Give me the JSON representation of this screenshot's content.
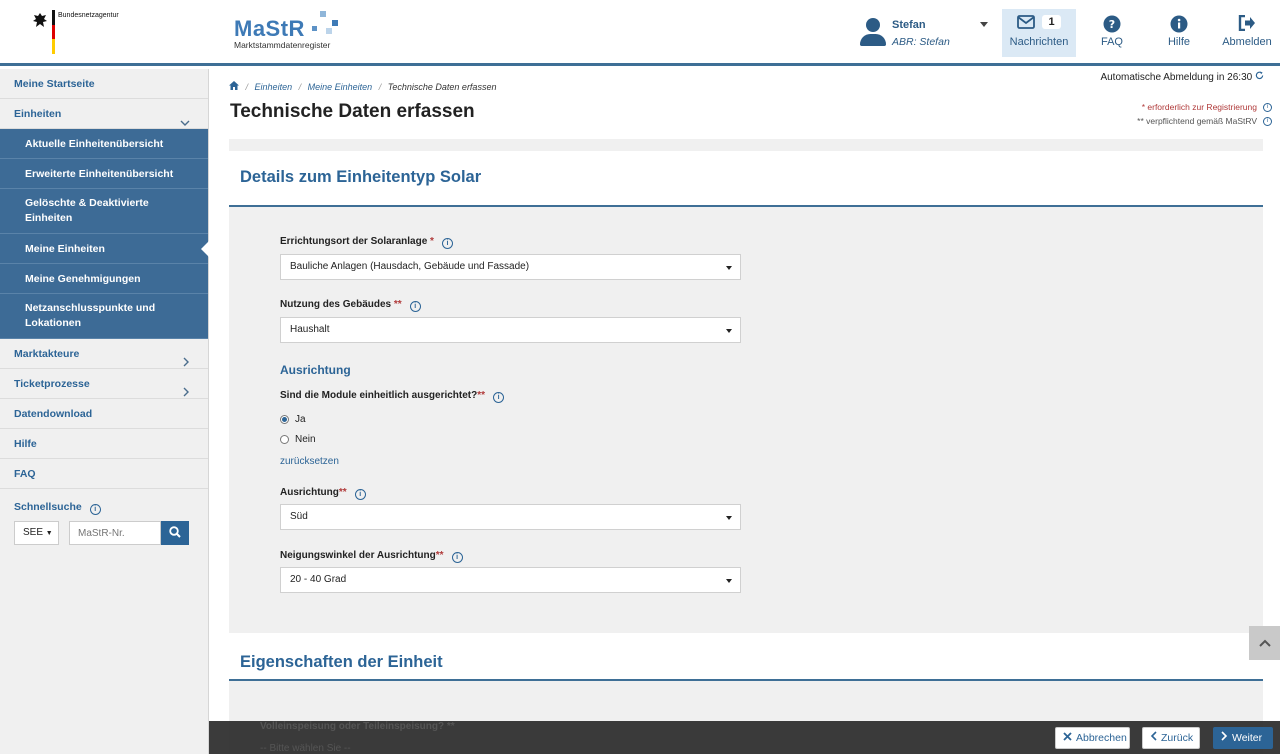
{
  "header": {
    "agency": "Bundesnetzagentur",
    "logo_title": "MaStR",
    "logo_sub": "Marktstammdatenregister",
    "user_name": "Stefan",
    "user_abr": "ABR: Stefan",
    "messages_label": "Nachrichten",
    "messages_count": "1",
    "faq_label": "FAQ",
    "hilfe_label": "Hilfe",
    "abmelden_label": "Abmelden"
  },
  "sidebar": {
    "startseite": "Meine Startseite",
    "einheiten": "Einheiten",
    "sub": [
      "Aktuelle Einheitenübersicht",
      "Erweiterte Einheitenübersicht",
      "Gelöschte & Deaktivierte Einheiten",
      "Meine Einheiten",
      "Meine Genehmigungen",
      "Netzanschlusspunkte und Lokationen"
    ],
    "marktakteure": "Marktakteure",
    "ticketprozesse": "Ticketprozesse",
    "datendownload": "Datendownload",
    "hilfe": "Hilfe",
    "faq": "FAQ",
    "schnellsuche": "Schnellsuche",
    "see_option": "SEE",
    "search_placeholder": "MaStR-Nr."
  },
  "breadcrumb": {
    "items": [
      "Einheiten",
      "Meine Einheiten"
    ],
    "current": "Technische Daten erfassen"
  },
  "auto_logout": "Automatische Abmeldung in 26:30",
  "page_title": "Technische Daten erfassen",
  "notes": {
    "required": "* erforderlich zur Registrierung",
    "mandatory": "** verpflichtend gemäß MaStRV"
  },
  "section1": {
    "title": "Details zum Einheitentyp Solar",
    "errichtungsort_label": "Errichtungsort der Solaranlage",
    "errichtungsort_req": "*",
    "errichtungsort_value": "Bauliche Anlagen (Hausdach, Gebäude und Fassade)",
    "nutzung_label": "Nutzung des Gebäudes",
    "nutzung_req": "**",
    "nutzung_value": "Haushalt",
    "ausrichtung_head": "Ausrichtung",
    "module_question": "Sind die Module einheitlich ausgerichtet?",
    "module_req": "**",
    "radio_ja": "Ja",
    "radio_nein": "Nein",
    "reset": "zurücksetzen",
    "ausrichtung_label": "Ausrichtung",
    "ausrichtung_req": "**",
    "ausrichtung_value": "Süd",
    "neigung_label": "Neigungswinkel der Ausrichtung",
    "neigung_req": "**",
    "neigung_value": "20 - 40 Grad"
  },
  "section2": {
    "title": "Eigenschaften der Einheit",
    "voll_label": "Volleinspeisung oder Teileinspeisung?",
    "voll_req": "**",
    "voll_placeholder": "-- Bitte wählen Sie --"
  },
  "footer": {
    "abbrechen": "Abbrechen",
    "zurueck": "Zurück",
    "weiter": "Weiter"
  }
}
